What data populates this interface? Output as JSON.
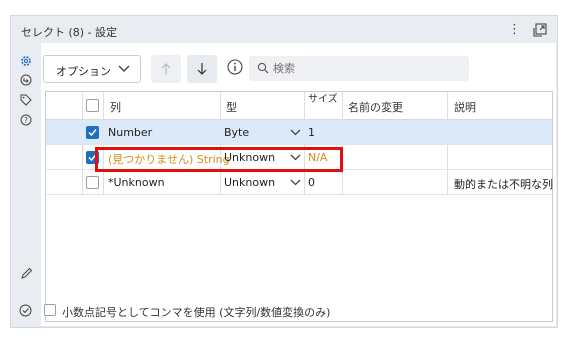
{
  "header": {
    "title": "セレクト (8) - 設定",
    "more_icon": "⋮",
    "popout_icon": "popout-icon"
  },
  "sidebar": {
    "icons": [
      "gear-icon",
      "return-icon",
      "tag-icon",
      "help-icon",
      "pencil-icon",
      "check-circle-icon"
    ]
  },
  "toolbar": {
    "options_label": "オプション",
    "move_up_icon": "arrow-up-icon",
    "move_down_icon": "arrow-down-icon",
    "info_icon": "info-icon",
    "search_placeholder": "検索"
  },
  "table": {
    "columns": {
      "field": "列",
      "type": "型",
      "size": "サイズ",
      "rename": "名前の変更",
      "description": "説明"
    },
    "rows": [
      {
        "checked": true,
        "field": "Number",
        "type": "Byte",
        "size": "1",
        "rename": "",
        "description": "",
        "missing": false
      },
      {
        "checked": true,
        "field": "(見つかりません) String",
        "type": "Unknown",
        "size": "N/A",
        "rename": "",
        "description": "",
        "missing": true
      },
      {
        "checked": false,
        "field": "*Unknown",
        "type": "Unknown",
        "size": "0",
        "rename": "",
        "description": "動的または不明な列",
        "missing": false
      }
    ]
  },
  "footer": {
    "decimal_comma_label": "小数点記号としてコンマを使用 (文字列/数値変換のみ)",
    "decimal_comma_checked": false
  },
  "colors": {
    "selected_row": "#dce9f8",
    "checkbox": "#1f6fc0",
    "missing_text": "#d98c1a",
    "highlight": "#e01010"
  }
}
